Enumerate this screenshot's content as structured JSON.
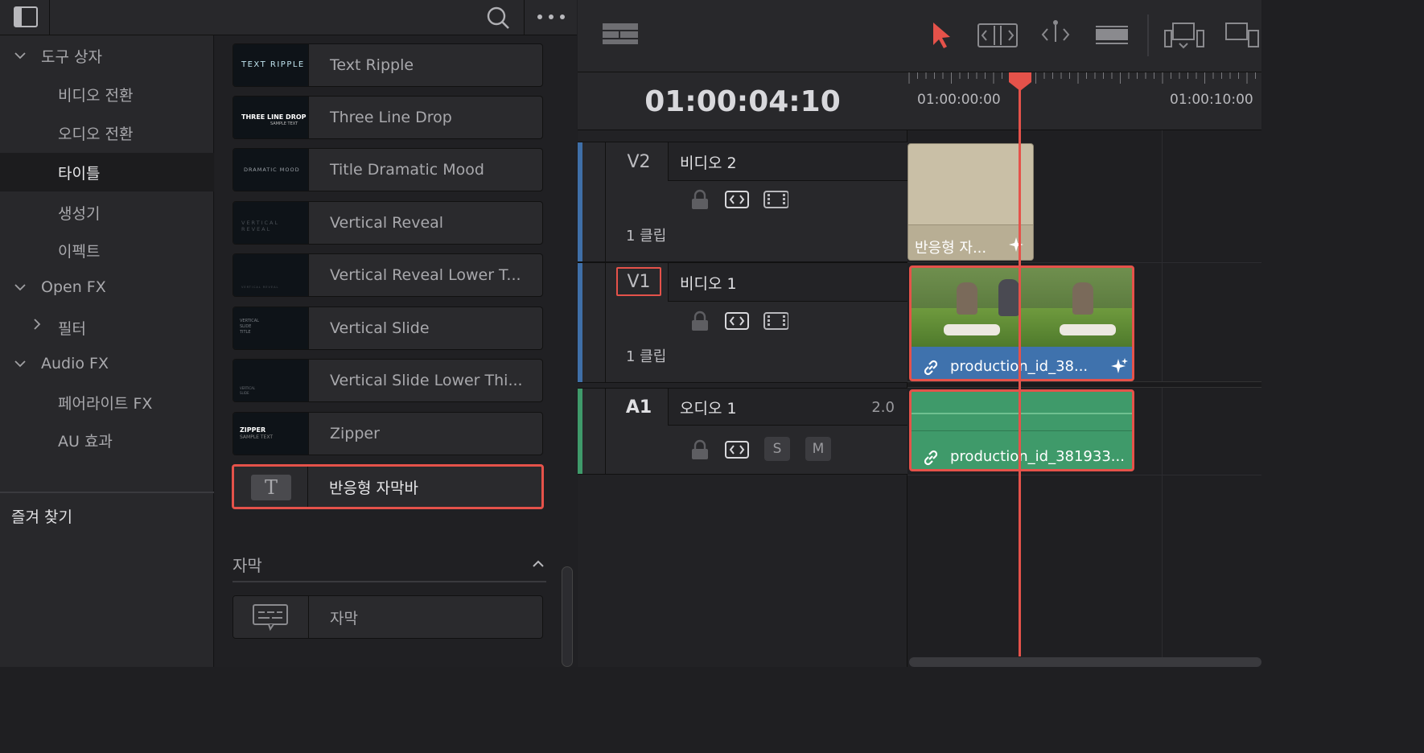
{
  "library": {
    "sidebar": {
      "items": [
        {
          "label": "도구 상자"
        },
        {
          "label": "비디오 전환"
        },
        {
          "label": "오디오 전환"
        },
        {
          "label": "타이틀"
        },
        {
          "label": "생성기"
        },
        {
          "label": "이펙트"
        },
        {
          "label": "Open FX"
        },
        {
          "label": "필터"
        },
        {
          "label": "Audio FX"
        },
        {
          "label": "페어라이트 FX"
        },
        {
          "label": "AU 효과"
        }
      ],
      "favorites_label": "즐겨 찾기"
    },
    "titles": [
      {
        "label": "Text Ripple",
        "thumb": "TEXT RIPPLE"
      },
      {
        "label": "Three Line Drop",
        "thumb": "THREE LINE DROP",
        "thumb_small": "SAMPLE TEXT"
      },
      {
        "label": "Title Dramatic Mood",
        "thumb": "DRAMATIC MOOD"
      },
      {
        "label": "Vertical Reveal",
        "thumb": "VERTICAL REVEAL"
      },
      {
        "label": "Vertical Reveal Lower T...",
        "thumb": "VERTICAL REVEAL"
      },
      {
        "label": "Vertical Slide",
        "thumb_lines": [
          "VERTICAL",
          "SLIDE",
          "TITLE"
        ]
      },
      {
        "label": "Vertical Slide Lower Thi...",
        "thumb_lines": [
          "VERTICAL",
          "SLIDE"
        ]
      },
      {
        "label": "Zipper",
        "thumb": "ZIPPER",
        "thumb_small": "SAMPLE TEXT"
      },
      {
        "label": "반응형 자막바",
        "thumb": "T"
      }
    ],
    "subtitles_section": {
      "title": "자막",
      "items": [
        {
          "label": "자막"
        }
      ]
    }
  },
  "timeline": {
    "timecode": "01:00:04:10",
    "ruler_labels": [
      "01:00:00:00",
      "01:00:10:00"
    ],
    "playhead_color": "#e5524a",
    "tracks": [
      {
        "id": "V2",
        "name": "비디오 2",
        "clip_count": "1 클립",
        "color": "#3f6fa8"
      },
      {
        "id": "V1",
        "name": "비디오 1",
        "clip_count": "1 클립",
        "color": "#3f6fa8"
      },
      {
        "id": "A1",
        "name": "오디오 1",
        "channel": "2.0",
        "color": "#3f9a6a",
        "solo": "S",
        "mute": "M"
      }
    ],
    "clips": {
      "title_clip": {
        "label": "반응형 자...",
        "color": "#c9bfa6"
      },
      "video_clip": {
        "label": "production_id_38...",
        "color": "#3f72ad"
      },
      "audio_clip": {
        "label": "production_id_381933...",
        "color": "#3f9a6a"
      }
    }
  }
}
